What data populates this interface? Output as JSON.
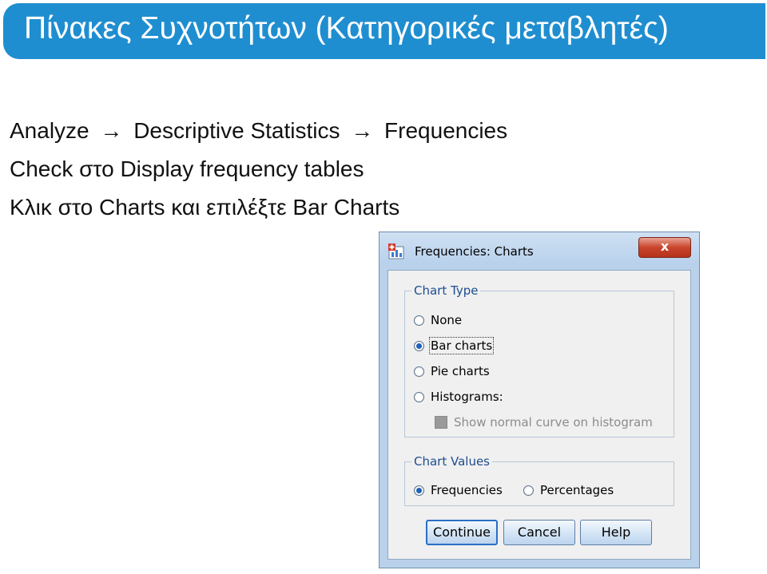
{
  "slide": {
    "title": "Πίνακες Συχνοτήτων (Κατηγορικές μεταβλητές)",
    "line1": {
      "a": "Analyze",
      "b": "Descriptive Statistics",
      "c": "Frequencies",
      "arrow": "→"
    },
    "line2": "Check στο Display frequency tables",
    "line3": "Κλικ στο Charts και επιλέξτε Bar Charts"
  },
  "dialog": {
    "title": "Frequencies: Charts",
    "close_label": "x",
    "chart_type": {
      "legend": "Chart Type",
      "options": [
        {
          "label": "None",
          "checked": false
        },
        {
          "label": "Bar charts",
          "checked": true
        },
        {
          "label": "Pie charts",
          "checked": false
        },
        {
          "label": "Histograms:",
          "checked": false
        }
      ],
      "normal_curve": {
        "label": "Show normal curve on histogram",
        "enabled": false
      }
    },
    "chart_values": {
      "legend": "Chart Values",
      "frequencies": "Frequencies",
      "percentages": "Percentages",
      "selected": "Frequencies"
    },
    "buttons": {
      "continue": "Continue",
      "cancel": "Cancel",
      "help": "Help"
    }
  },
  "icons": {
    "dialog": "spss-dialog-icon",
    "close": "close-icon"
  },
  "colors": {
    "title_bar": "#1f8ed0",
    "dialog_frame": "#b9d1ea",
    "legend_text": "#1d4d8f"
  }
}
